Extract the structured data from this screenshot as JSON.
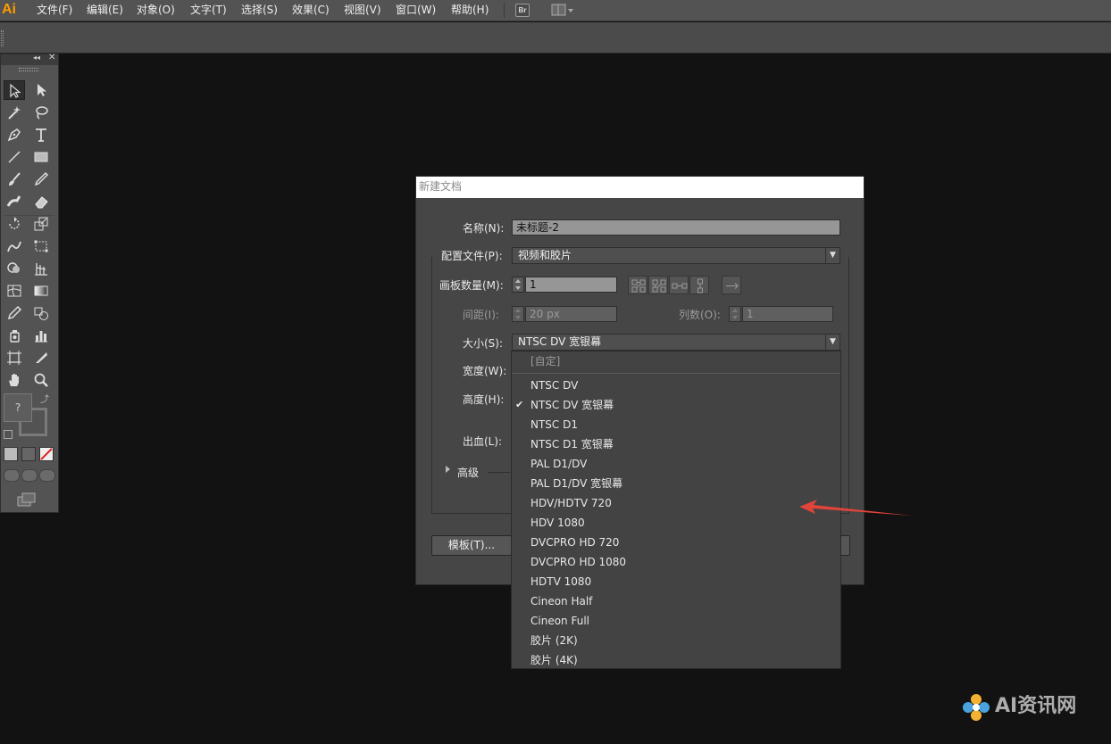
{
  "app": {
    "logo_text": "Ai"
  },
  "menu": {
    "items": [
      "文件(F)",
      "编辑(E)",
      "对象(O)",
      "文字(T)",
      "选择(S)",
      "效果(C)",
      "视图(V)",
      "窗口(W)",
      "帮助(H)"
    ],
    "bridge_label": "Br"
  },
  "dialog": {
    "title": "新建文档",
    "name": {
      "label": "名称(N):",
      "value": "未标题-2"
    },
    "profile": {
      "label": "配置文件(P):",
      "value": "视频和胶片"
    },
    "artboards": {
      "label": "画板数量(M):",
      "value": "1"
    },
    "spacing": {
      "label": "间距(I):",
      "value": "20 px"
    },
    "columns": {
      "label": "列数(O):",
      "value": "1"
    },
    "size": {
      "label": "大小(S):",
      "value": "NTSC DV 宽银幕"
    },
    "width": {
      "label": "宽度(W):"
    },
    "height": {
      "label": "高度(H):"
    },
    "bleed": {
      "label": "出血(L):"
    },
    "advanced": {
      "label": "高级"
    },
    "templates_button": "模板(T)..."
  },
  "size_options": {
    "custom": "[自定]",
    "items": [
      "NTSC DV",
      "NTSC DV 宽银幕",
      "NTSC D1",
      "NTSC D1 宽银幕",
      "PAL D1/DV",
      "PAL D1/DV 宽银幕",
      "HDV/HDTV 720",
      "HDV 1080",
      "DVCPRO HD 720",
      "DVCPRO HD 1080",
      "HDTV 1080",
      "Cineon Half",
      "Cineon Full",
      "胶片 (2K)",
      "胶片 (4K)"
    ],
    "selected_index": 1
  },
  "watermark": {
    "text": "AI资讯网"
  },
  "colors": {
    "logo": "#ff9a00",
    "arrow": "#e0443a",
    "canvas": "#121212"
  }
}
